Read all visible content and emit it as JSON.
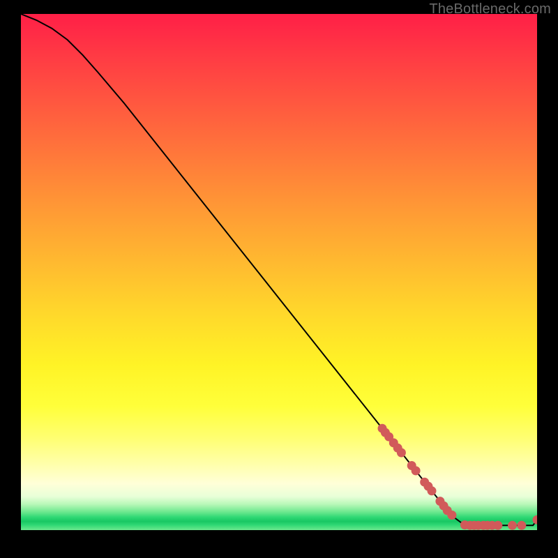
{
  "watermark": "TheBottleneck.com",
  "colors": {
    "dot": "#d15a5a",
    "curve": "#000000"
  },
  "chart_data": {
    "type": "line",
    "title": "",
    "xlabel": "",
    "ylabel": "",
    "xlim": [
      0,
      100
    ],
    "ylim": [
      0,
      100
    ],
    "curve": [
      {
        "x": 0,
        "y": 100
      },
      {
        "x": 3,
        "y": 98.8
      },
      {
        "x": 6,
        "y": 97.2
      },
      {
        "x": 9,
        "y": 95.0
      },
      {
        "x": 12,
        "y": 92.0
      },
      {
        "x": 15,
        "y": 88.6
      },
      {
        "x": 20,
        "y": 82.7
      },
      {
        "x": 30,
        "y": 70.1
      },
      {
        "x": 40,
        "y": 57.5
      },
      {
        "x": 50,
        "y": 44.9
      },
      {
        "x": 60,
        "y": 32.3
      },
      {
        "x": 70,
        "y": 19.7
      },
      {
        "x": 78,
        "y": 9.6
      },
      {
        "x": 82,
        "y": 4.6
      },
      {
        "x": 84,
        "y": 2.4
      },
      {
        "x": 85.5,
        "y": 1.3
      },
      {
        "x": 86.5,
        "y": 0.9
      },
      {
        "x": 88,
        "y": 0.9
      },
      {
        "x": 92,
        "y": 0.9
      },
      {
        "x": 96,
        "y": 0.9
      },
      {
        "x": 99.2,
        "y": 0.9
      },
      {
        "x": 100,
        "y": 2.0
      }
    ],
    "scatter": [
      {
        "x": 70.0,
        "y": 19.7
      },
      {
        "x": 70.6,
        "y": 18.9
      },
      {
        "x": 71.3,
        "y": 18.1
      },
      {
        "x": 72.2,
        "y": 16.9
      },
      {
        "x": 73.0,
        "y": 15.9
      },
      {
        "x": 73.7,
        "y": 15.0
      },
      {
        "x": 75.7,
        "y": 12.5
      },
      {
        "x": 76.5,
        "y": 11.5
      },
      {
        "x": 78.2,
        "y": 9.3
      },
      {
        "x": 78.9,
        "y": 8.5
      },
      {
        "x": 79.6,
        "y": 7.6
      },
      {
        "x": 81.2,
        "y": 5.6
      },
      {
        "x": 81.9,
        "y": 4.7
      },
      {
        "x": 82.6,
        "y": 3.8
      },
      {
        "x": 83.5,
        "y": 2.9
      },
      {
        "x": 86.0,
        "y": 1.0
      },
      {
        "x": 87.0,
        "y": 0.9
      },
      {
        "x": 87.8,
        "y": 0.9
      },
      {
        "x": 88.6,
        "y": 0.9
      },
      {
        "x": 89.6,
        "y": 0.9
      },
      {
        "x": 90.4,
        "y": 0.9
      },
      {
        "x": 91.3,
        "y": 0.9
      },
      {
        "x": 92.4,
        "y": 0.9
      },
      {
        "x": 95.2,
        "y": 0.9
      },
      {
        "x": 97.0,
        "y": 0.9
      },
      {
        "x": 100.0,
        "y": 2.0
      }
    ]
  }
}
